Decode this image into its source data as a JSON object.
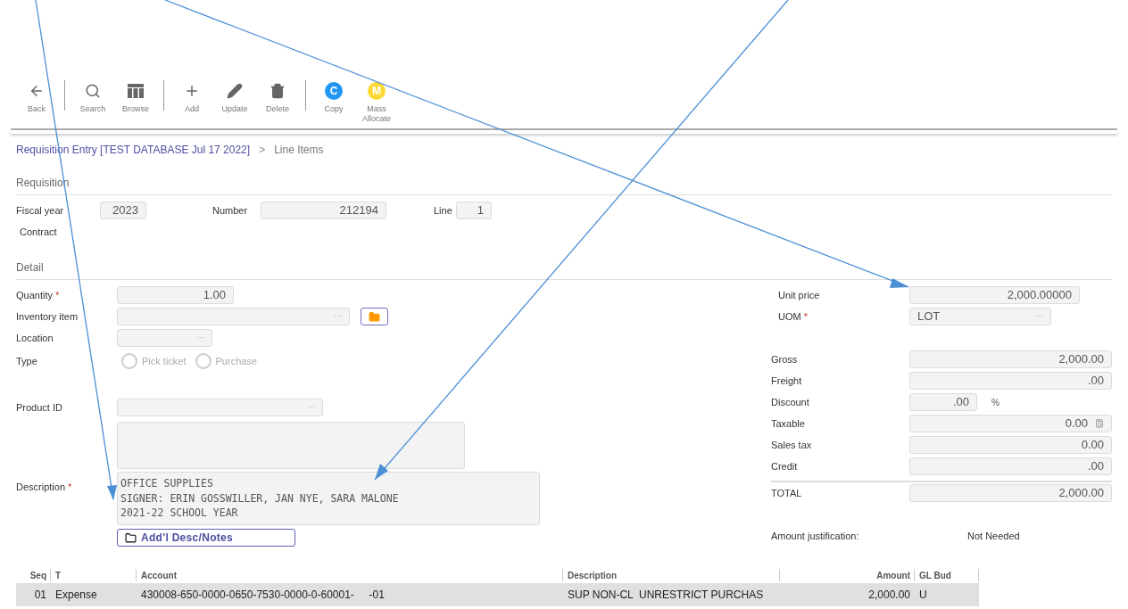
{
  "toolbar": [
    {
      "kind": "back",
      "label": "Back"
    },
    {
      "kind": "separator"
    },
    {
      "kind": "search",
      "label": "Search"
    },
    {
      "kind": "browse",
      "label": "Browse"
    },
    {
      "kind": "separator"
    },
    {
      "kind": "add",
      "label": "Add"
    },
    {
      "kind": "update",
      "label": "Update"
    },
    {
      "kind": "delete",
      "label": "Delete"
    },
    {
      "kind": "separator"
    },
    {
      "kind": "letter",
      "letter": "C",
      "color": "#2196f3",
      "label": "Copy"
    },
    {
      "kind": "letter",
      "letter": "M",
      "color": "#fdd835",
      "label": "Mass Allocate"
    }
  ],
  "breadcrumb": {
    "parent": "Requisition Entry [TEST DATABASE Jul 17 2022]",
    "separator": ">",
    "current": "Line Items"
  },
  "requisition": {
    "title": "Requisition",
    "fields": [
      {
        "label": "Fiscal year",
        "value": "2023"
      },
      {
        "label": "Number",
        "value": "212194"
      },
      {
        "label": "Line",
        "value": "1"
      }
    ],
    "contract_label": "Contract"
  },
  "detail": {
    "title": "Detail",
    "left": [
      {
        "kind": "number",
        "label": "Quantity",
        "required_mark": "*",
        "value": "1.00"
      },
      {
        "kind": "lookup",
        "label": "Inventory item",
        "lookup_glyph": "···",
        "folder_button": true
      },
      {
        "kind": "lookup",
        "label": "Location",
        "lookup_glyph": "···",
        "folder_button": false
      },
      {
        "kind": "radio",
        "label": "Type",
        "options": [
          {
            "label": "Pick ticket",
            "selected": false
          },
          {
            "label": "Purchase",
            "selected": false
          }
        ]
      },
      {
        "kind": "lookup",
        "label": "Product ID",
        "lookup_glyph": "···",
        "folder_button": false
      },
      {
        "kind": "textarea"
      },
      {
        "kind": "description",
        "label": "Description",
        "required_mark": "*",
        "lines": [
          "OFFICE SUPPLIES",
          "SIGNER: ERIN GOSSWILLER, JAN NYE, SARA MALONE",
          "2021-22 SCHOOL YEAR"
        ],
        "button": "Add'l Desc/Notes"
      }
    ],
    "pricing": [
      {
        "kind": "number",
        "label": "Unit price",
        "value": "2,000.00000"
      },
      {
        "kind": "lookup",
        "label": "UOM",
        "required_mark": "*",
        "value": "LOT",
        "lookup_glyph": "···"
      }
    ],
    "totals": [
      {
        "label": "Gross",
        "value": "2,000.00"
      },
      {
        "label": "Freight",
        "value": ".00"
      },
      {
        "label": "Discount",
        "value": ".00",
        "suffix": "%"
      },
      {
        "label": "Taxable",
        "value": "0.00",
        "calculator": true
      },
      {
        "label": "Sales tax",
        "value": "0.00"
      },
      {
        "label": "Credit",
        "value": ".00"
      },
      {
        "label": "TOTAL",
        "value": "2,000.00",
        "rule_above": true
      }
    ],
    "justification": {
      "label": "Amount justification:",
      "value": "Not Needed"
    }
  },
  "table": {
    "columns": [
      "Seq",
      "T",
      "Account",
      "Description",
      "Amount",
      "GL Bud"
    ],
    "rows": [
      {
        "selected": true,
        "cells": [
          "01",
          "Expense",
          "430008-650-0000-0650-7530-0000-0-60001-     -01",
          "SUP NON-CL  UNRESTRICT PURCHAS",
          "2,000.00",
          "U"
        ]
      }
    ]
  }
}
